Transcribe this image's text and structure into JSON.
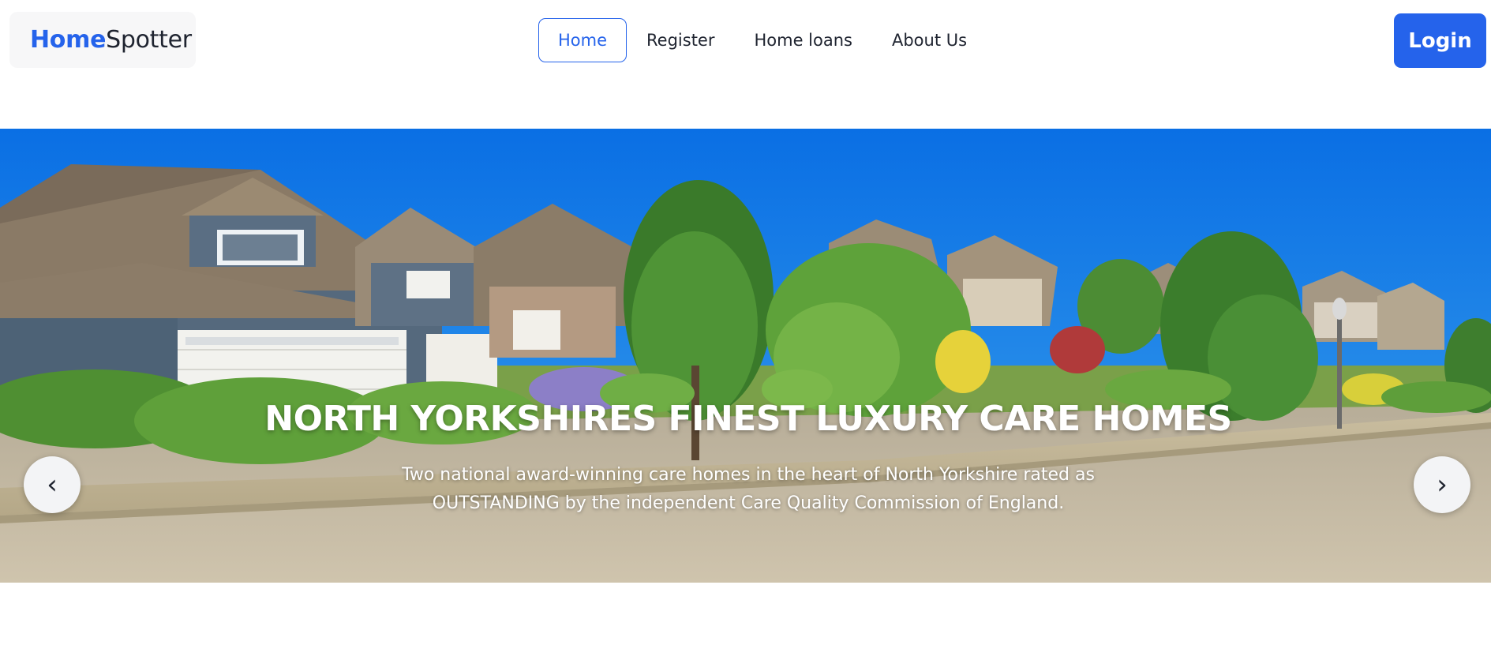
{
  "header": {
    "logo_part1": "Home",
    "logo_part2": "Spotter",
    "nav": [
      {
        "label": "Home",
        "active": true
      },
      {
        "label": "Register",
        "active": false
      },
      {
        "label": "Home loans",
        "active": false
      },
      {
        "label": "About Us",
        "active": false
      }
    ],
    "login_label": "Login"
  },
  "hero": {
    "title": "NORTH YORKSHIRES FINEST LUXURY CARE HOMES",
    "subtitle_line1": "Two national award-winning care homes in the heart of North Yorkshire rated as",
    "subtitle_line2": "OUTSTANDING by the independent Care Quality Commission of England.",
    "prev_icon": "chevron-left-icon",
    "next_icon": "chevron-right-icon",
    "prev_glyph": "‹",
    "next_glyph": "›"
  },
  "colors": {
    "accent": "#2563eb",
    "text": "#1f2430",
    "sky": "#0a78e6"
  }
}
